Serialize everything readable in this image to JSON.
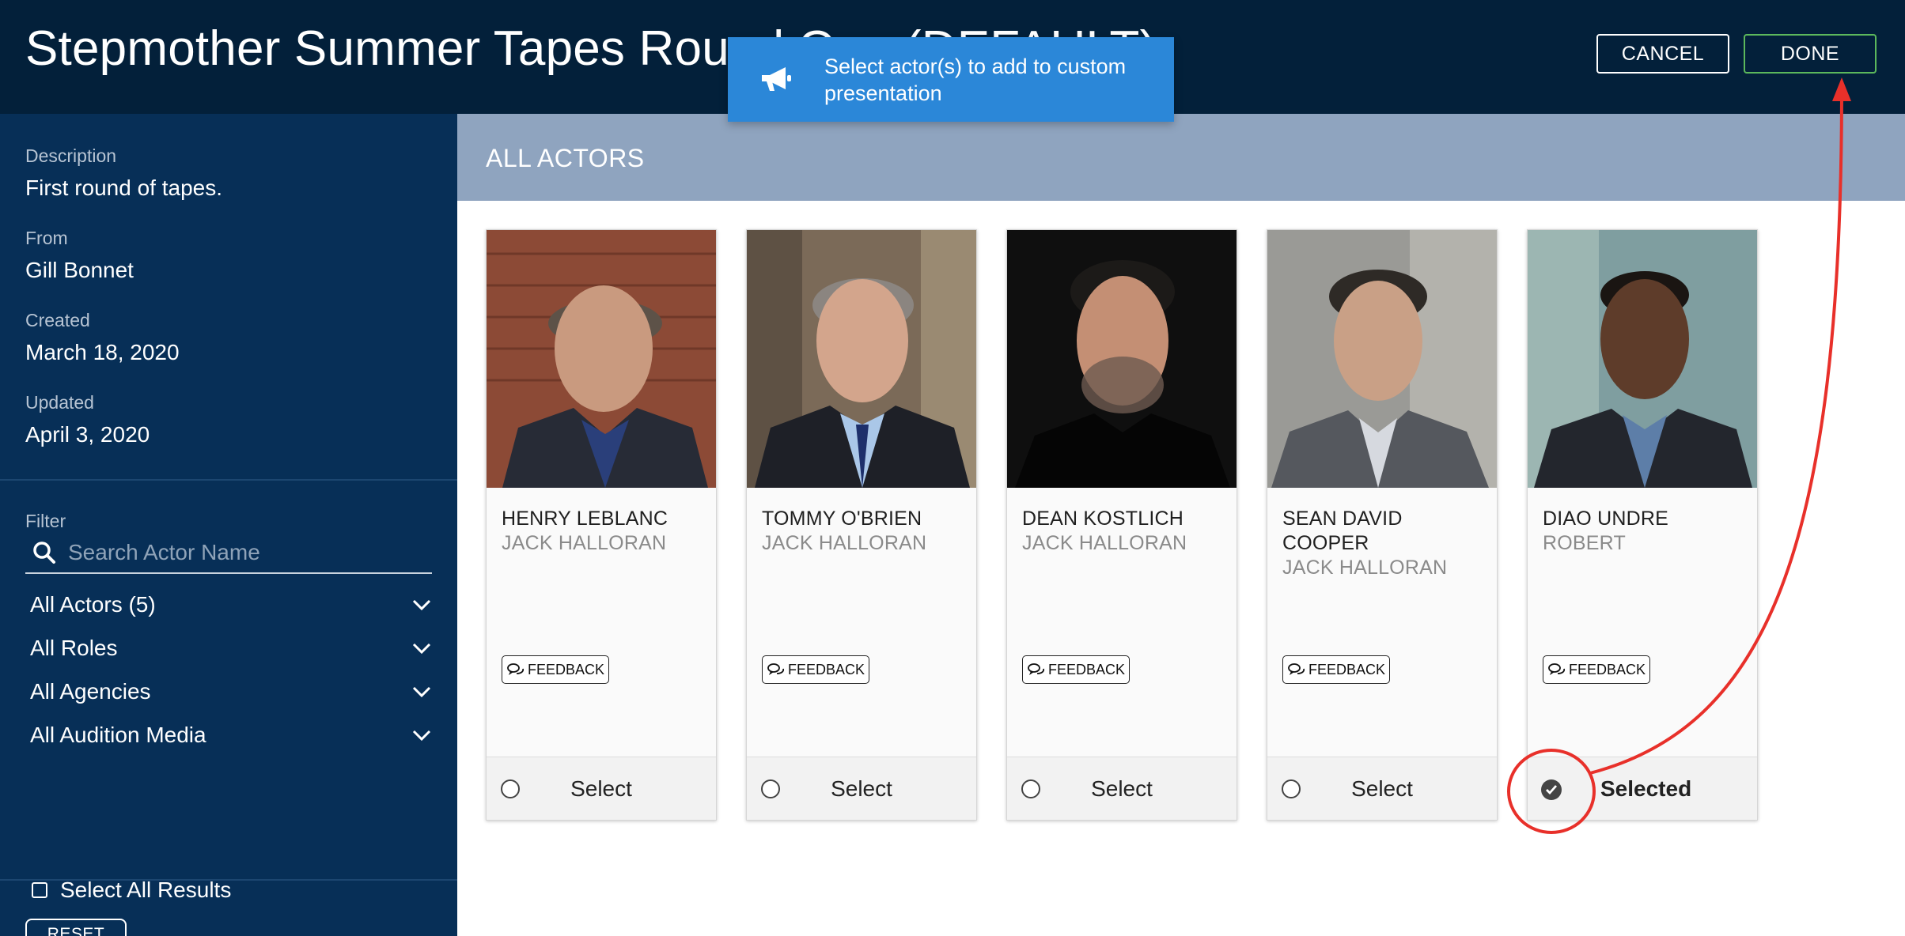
{
  "header": {
    "title": "Stepmother Summer Tapes Round One (DEFAULT)",
    "cancel_label": "CANCEL",
    "done_label": "DONE"
  },
  "toast": {
    "message": "Select actor(s) to add to custom presentation",
    "icon": "megaphone-icon"
  },
  "sidebar": {
    "description_label": "Description",
    "description_value": "First round of tapes.",
    "from_label": "From",
    "from_value": "Gill Bonnet",
    "created_label": "Created",
    "created_value": "March 18, 2020",
    "updated_label": "Updated",
    "updated_value": "April 3, 2020",
    "filter_label": "Filter",
    "search_placeholder": "Search Actor Name",
    "filters": [
      {
        "label": "All Actors (5)"
      },
      {
        "label": "All Roles"
      },
      {
        "label": "All Agencies"
      },
      {
        "label": "All Audition Media"
      }
    ],
    "select_all_label": "Select All Results",
    "select_all_checked": false,
    "reset_label": "RESET"
  },
  "main": {
    "section_title": "ALL ACTORS",
    "feedback_label": "FEEDBACK",
    "select_label": "Select",
    "selected_label": "Selected",
    "actors": [
      {
        "name": "HENRY LEBLANC",
        "role": "JACK HALLORAN",
        "selected": false
      },
      {
        "name": "TOMMY O'BRIEN",
        "role": "JACK HALLORAN",
        "selected": false
      },
      {
        "name": "DEAN KOSTLICH",
        "role": "JACK HALLORAN",
        "selected": false
      },
      {
        "name": "SEAN DAVID COOPER",
        "role": "JACK HALLORAN",
        "selected": false
      },
      {
        "name": "DIAO UNDRE",
        "role": "ROBERT",
        "selected": true
      }
    ]
  },
  "colors": {
    "header_bg": "#03203a",
    "sidebar_bg": "#072f57",
    "section_bar_bg": "#8fa4bf",
    "toast_bg": "#2b87d8",
    "done_border": "#5cb85c",
    "annotation": "#e8302a"
  }
}
